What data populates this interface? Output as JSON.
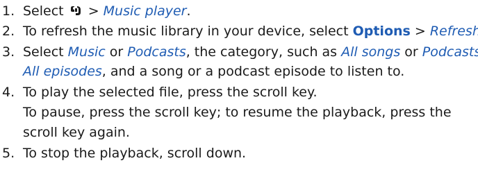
{
  "steps": [
    {
      "num": "1.",
      "text_a": "Select ",
      "sep": " > ",
      "link_a": "Music player",
      "end": "."
    },
    {
      "num": "2.",
      "text_a": "To refresh the music library in your device, select ",
      "bold_a": "Options",
      "sep": " > ",
      "link_a": "Refresh",
      "end": "."
    },
    {
      "num": "3.",
      "text_a": "Select ",
      "link_a": "Music",
      "or": " or ",
      "link_b": "Podcasts",
      "text_b": ", the category, such as ",
      "link_c": "All songs",
      "or2": " or ",
      "link_d": "Podcasts",
      "sep": " >",
      "line2_link": "All episodes",
      "line2_text": ", and a song or a podcast episode to listen to."
    },
    {
      "num": "4.",
      "text_a": "To play the selected file, press the scroll key.",
      "line2": "To pause, press the scroll key; to resume the playback, press the",
      "line3": "scroll key again."
    },
    {
      "num": "5.",
      "text_a": "To stop the playback, scroll down."
    }
  ],
  "icons": {
    "menu": "menu-key-icon"
  },
  "colors": {
    "link": "#1f5cb3",
    "text": "#1a1a1a"
  }
}
